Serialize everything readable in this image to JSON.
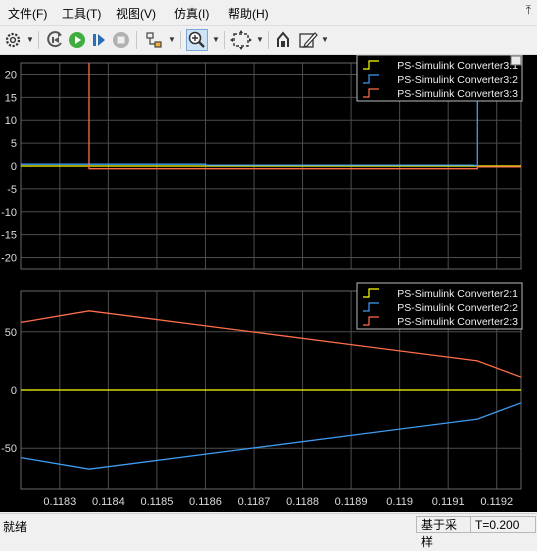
{
  "menu": [
    "文件(F)",
    "工具(T)",
    "视图(V)",
    "仿真(I)",
    "帮助(H)"
  ],
  "toolbar": {
    "icons": [
      "gear-icon",
      "rewind-icon",
      "run-icon",
      "step-forward-icon",
      "stop-icon",
      "highlight-icon",
      "zoom-icon",
      "fit-axes-icon",
      "style-icon",
      "edit-icon"
    ]
  },
  "colors": {
    "background": "#000000",
    "axes": "#696969",
    "grid": "#4d4d4d",
    "tick_text": "#dcdcdc",
    "series1": "#ffff00",
    "series2": "#3d9df2",
    "series3": "#ff6e4a"
  },
  "status": {
    "left": "就绪",
    "mode": "基于采样",
    "time": "T=0.200"
  },
  "chart_data": [
    {
      "type": "line",
      "ylim": [
        -22.5,
        22.5
      ],
      "yticks": [
        -20,
        -15,
        -10,
        -5,
        0,
        5,
        10,
        15,
        20
      ],
      "xlim": [
        0.11822,
        0.11925
      ],
      "grid": true,
      "legend_position": "top-right",
      "series": [
        {
          "name": "PS-Simulink Converter3:1",
          "color": "#ffff00",
          "x": [
            0.11822,
            0.11925
          ],
          "y": [
            0,
            0
          ]
        },
        {
          "name": "PS-Simulink Converter3:2",
          "color": "#3d9df2",
          "x": [
            0.11822,
            0.1186,
            0.1186,
            0.11915,
            0.11916,
            0.11916
          ],
          "y": [
            0.4,
            0.4,
            0.2,
            0.2,
            0.1,
            22.5
          ]
        },
        {
          "name": "PS-Simulink Converter3:3",
          "color": "#ff6e4a",
          "x": [
            0.11836,
            0.11836,
            0.11916,
            0.11916,
            0.11925
          ],
          "y": [
            22.5,
            -0.6,
            -0.6,
            -0.2,
            -0.2
          ]
        }
      ]
    },
    {
      "type": "line",
      "ylim": [
        -85,
        85
      ],
      "yticks": [
        -50,
        0,
        50
      ],
      "xlim": [
        0.11822,
        0.11925
      ],
      "xticks": [
        0.1183,
        0.1184,
        0.1185,
        0.1186,
        0.1187,
        0.1188,
        0.1189,
        0.119,
        0.1191,
        0.1192
      ],
      "grid": true,
      "legend_position": "top-right",
      "series": [
        {
          "name": "PS-Simulink Converter2:1",
          "color": "#ffff00",
          "x": [
            0.11822,
            0.11925
          ],
          "y": [
            0,
            0
          ]
        },
        {
          "name": "PS-Simulink Converter2:2",
          "color": "#3d9df2",
          "x": [
            0.11822,
            0.11836,
            0.11916,
            0.11925
          ],
          "y": [
            -58,
            -68,
            -25,
            -11
          ]
        },
        {
          "name": "PS-Simulink Converter2:3",
          "color": "#ff6e4a",
          "x": [
            0.11822,
            0.11836,
            0.11916,
            0.11925
          ],
          "y": [
            58,
            68,
            25,
            11
          ]
        }
      ]
    }
  ]
}
